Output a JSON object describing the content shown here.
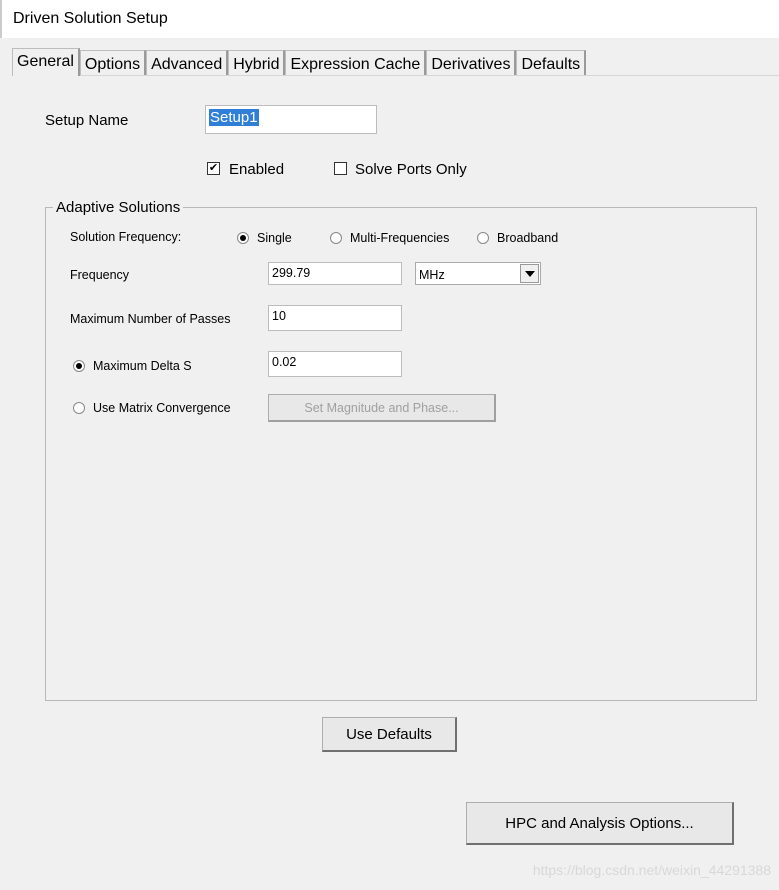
{
  "window": {
    "title": "Driven Solution Setup"
  },
  "tabs": [
    {
      "label": "General",
      "active": true
    },
    {
      "label": "Options"
    },
    {
      "label": "Advanced"
    },
    {
      "label": "Hybrid"
    },
    {
      "label": "Expression Cache"
    },
    {
      "label": "Derivatives"
    },
    {
      "label": "Defaults"
    }
  ],
  "general": {
    "setup_name_label": "Setup Name",
    "setup_name_value": "Setup1",
    "enabled_label": "Enabled",
    "enabled_checked": true,
    "solve_ports_only_label": "Solve Ports Only",
    "solve_ports_only_checked": false,
    "adaptive": {
      "title": "Adaptive Solutions",
      "solution_frequency_label": "Solution Frequency:",
      "freq_modes": [
        {
          "label": "Single",
          "selected": true
        },
        {
          "label": "Multi-Frequencies",
          "selected": false
        },
        {
          "label": "Broadband",
          "selected": false
        }
      ],
      "frequency_label": "Frequency",
      "frequency_value": "299.79",
      "frequency_unit": "MHz",
      "max_passes_label": "Maximum Number of Passes",
      "max_passes_value": "10",
      "max_delta_s_label": "Maximum Delta S",
      "max_delta_s_value": "0.02",
      "max_delta_s_selected": true,
      "matrix_convergence_label": "Use Matrix Convergence",
      "matrix_convergence_selected": false,
      "set_mag_phase_label": "Set Magnitude and Phase..."
    },
    "use_defaults_label": "Use Defaults",
    "hpc_label": "HPC and Analysis Options..."
  },
  "watermark": "https://blog.csdn.net/weixin_44291388"
}
